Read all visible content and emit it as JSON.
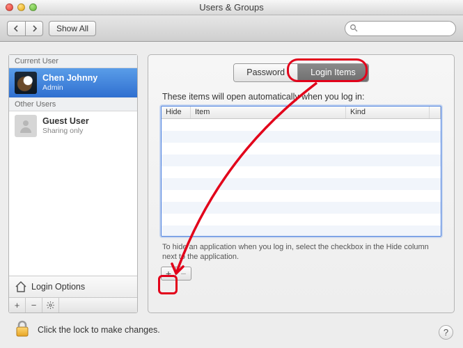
{
  "window": {
    "title": "Users & Groups"
  },
  "toolbar": {
    "showAll": "Show All",
    "searchPlaceholder": ""
  },
  "sidebar": {
    "sections": [
      {
        "header": "Current User"
      },
      {
        "header": "Other Users"
      }
    ],
    "currentUser": {
      "name": "Chen Johnny",
      "role": "Admin"
    },
    "otherUser": {
      "name": "Guest User",
      "role": "Sharing only"
    },
    "loginOptions": "Login Options"
  },
  "tabs": {
    "password": "Password",
    "loginItems": "Login Items"
  },
  "main": {
    "headline": "These items will open automatically when you log in:",
    "columns": {
      "hide": "Hide",
      "item": "Item",
      "kind": "Kind"
    },
    "hint": "To hide an application when you log in, select the checkbox in the Hide column next to the application."
  },
  "footer": {
    "lockText": "Click the lock to make changes."
  }
}
